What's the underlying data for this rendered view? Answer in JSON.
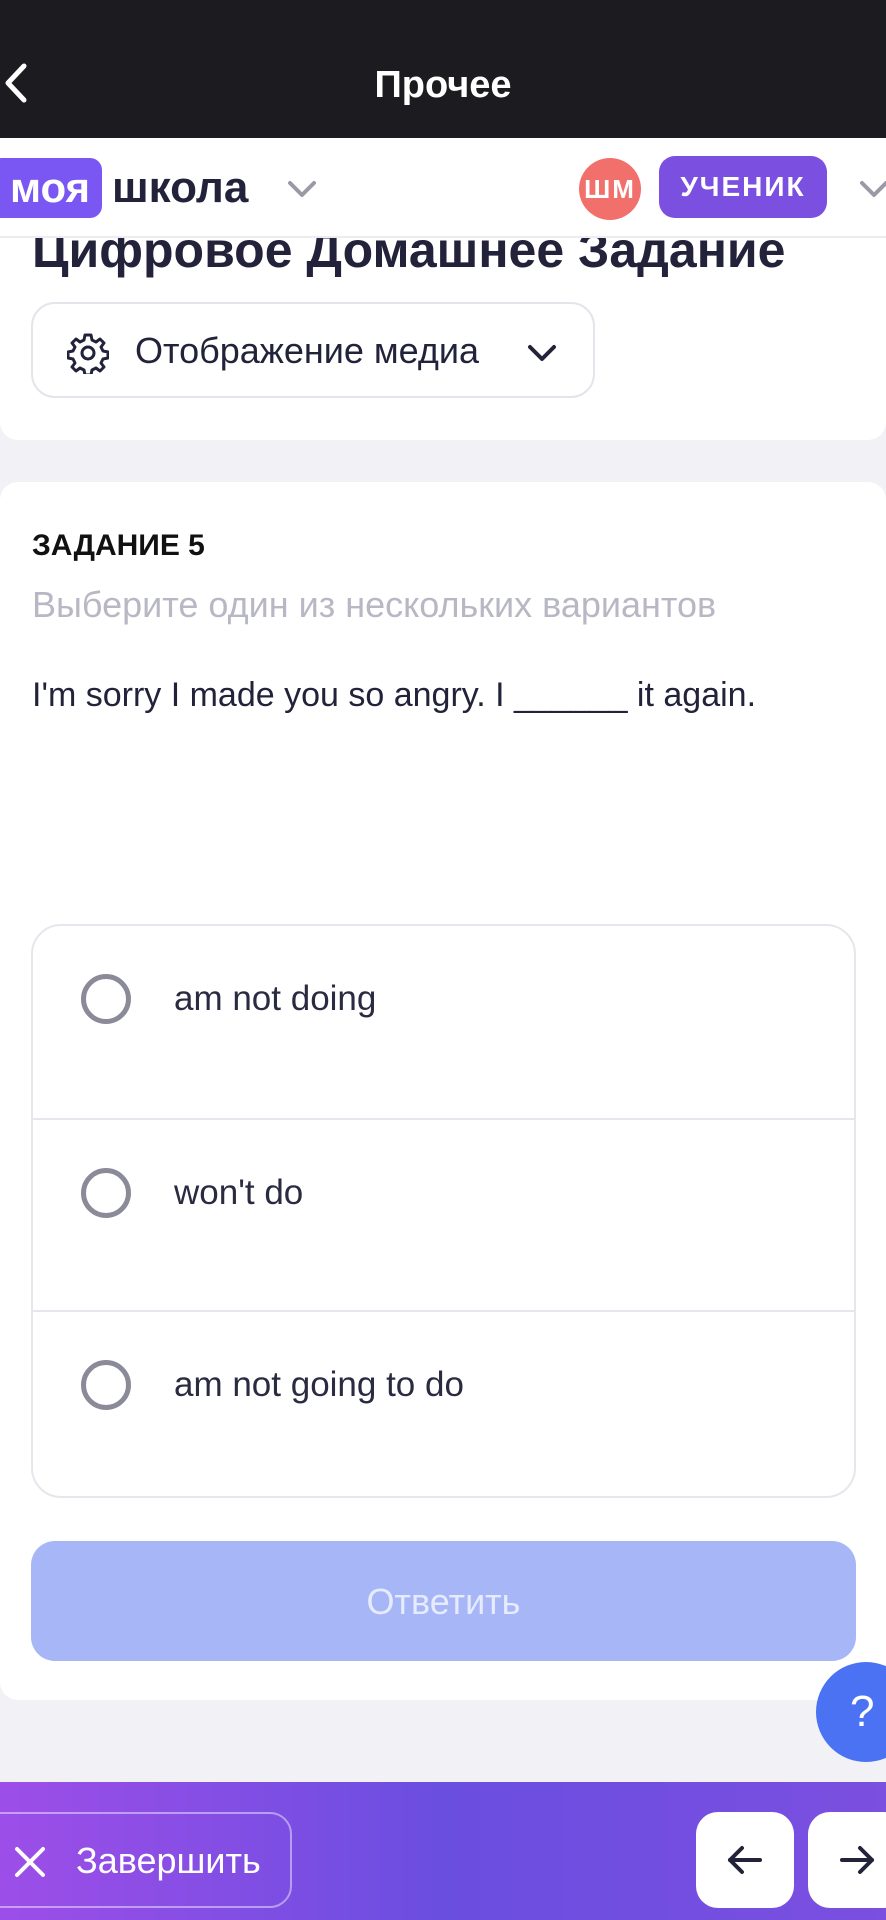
{
  "topbar": {
    "title": "Прочее"
  },
  "header": {
    "logo_part1": "моя",
    "logo_part2": "школа",
    "avatar_initials": "ШМ",
    "role": "УЧЕНИК",
    "hw_title": "Цифровое Домашнее Задание",
    "media_label": "Отображение медиа"
  },
  "task": {
    "number": "ЗАДАНИЕ 5",
    "hint": "Выберите один из нескольких вариантов",
    "question": "I'm sorry I made you so angry. I ______ it again.",
    "options": [
      {
        "label": "am not doing"
      },
      {
        "label": "won't do"
      },
      {
        "label": "am not going to do"
      }
    ],
    "answer_label": "Ответить"
  },
  "help": {
    "label": "?"
  },
  "bottombar": {
    "finish_label": "Завершить"
  },
  "colors": {
    "accent": "#7b4fe0",
    "avatar": "#f2706c",
    "answer_disabled": "#a6b6f7",
    "help": "#4a72f2"
  }
}
